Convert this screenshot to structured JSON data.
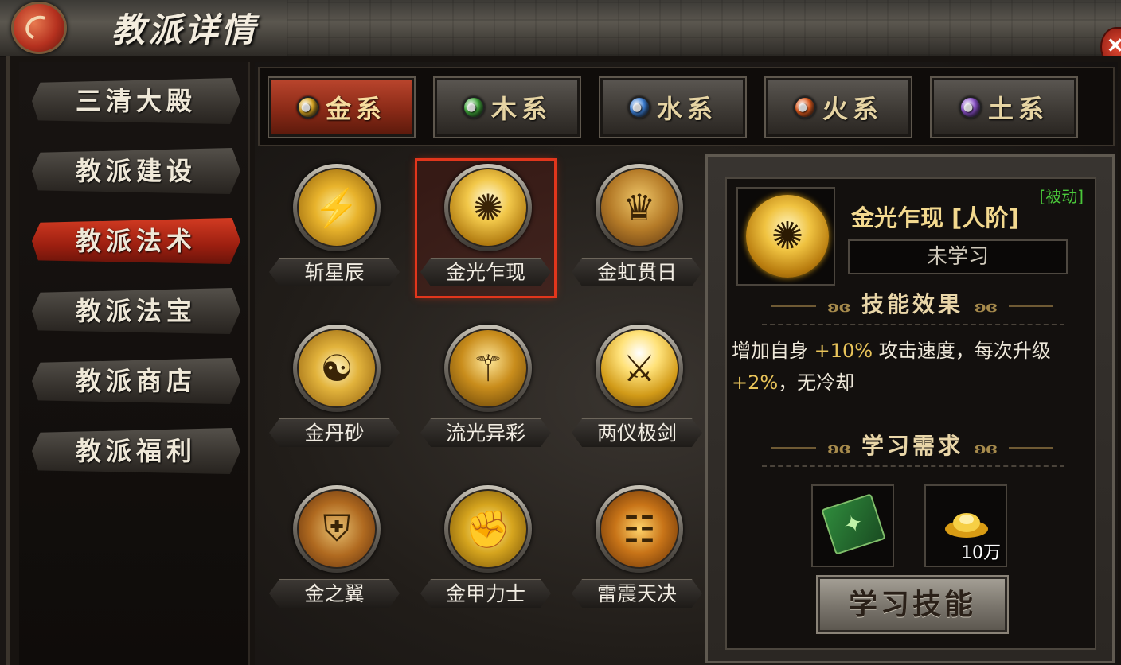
{
  "window": {
    "title": "教派详情",
    "close_symbol": "✕"
  },
  "sidebar": {
    "items": [
      {
        "label": "三清大殿",
        "active": false
      },
      {
        "label": "教派建设",
        "active": false
      },
      {
        "label": "教派法术",
        "active": true
      },
      {
        "label": "教派法宝",
        "active": false
      },
      {
        "label": "教派商店",
        "active": false
      },
      {
        "label": "教派福利",
        "active": false
      }
    ]
  },
  "tabs": [
    {
      "label": "金系",
      "active": true,
      "orb_color": "#d9a520"
    },
    {
      "label": "木系",
      "active": false,
      "orb_color": "#3fa83a"
    },
    {
      "label": "水系",
      "active": false,
      "orb_color": "#3b7fd6"
    },
    {
      "label": "火系",
      "active": false,
      "orb_color": "#e05a1c"
    },
    {
      "label": "土系",
      "active": false,
      "orb_color": "#8a4fc9"
    }
  ],
  "skills": [
    {
      "name": "斩星辰",
      "icon": "sword-lightning-icon",
      "glyph": "⚡",
      "selected": false
    },
    {
      "name": "金光乍现",
      "icon": "gourd-burst-icon",
      "glyph": "✺",
      "selected": true
    },
    {
      "name": "金虹贯日",
      "icon": "warrior-roar-icon",
      "glyph": "♛",
      "selected": false
    },
    {
      "name": "金丹砂",
      "icon": "taiji-icon",
      "glyph": "☯",
      "selected": false
    },
    {
      "name": "流光异彩",
      "icon": "sage-aura-icon",
      "glyph": "⚚",
      "selected": false
    },
    {
      "name": "两仪极剑",
      "icon": "sword-light-icon",
      "glyph": "⚔",
      "selected": false
    },
    {
      "name": "金之翼",
      "icon": "shield-icon",
      "glyph": "⛨",
      "selected": false
    },
    {
      "name": "金甲力士",
      "icon": "golden-gauntlet-icon",
      "glyph": "✊",
      "selected": false
    },
    {
      "name": "雷震天决",
      "icon": "thunder-chest-icon",
      "glyph": "☷",
      "selected": false
    }
  ],
  "detail": {
    "tag": "[被动]",
    "name": "金光乍现 [人阶]",
    "status": "未学习",
    "effect_heading": "技能效果",
    "effect_parts": [
      {
        "text": "增加自身 ",
        "highlight": false
      },
      {
        "text": "+10%",
        "highlight": true
      },
      {
        "text": " 攻击速度，每次升级 ",
        "highlight": false
      },
      {
        "text": "+2%",
        "highlight": true
      },
      {
        "text": "，无冷却",
        "highlight": false
      }
    ],
    "requirement_heading": "学习需求",
    "requirements": [
      {
        "item": "skill-book-icon",
        "glyph": "📗",
        "count": ""
      },
      {
        "item": "gold-ingot-icon",
        "glyph": "🥇",
        "count": "10万"
      }
    ],
    "learn_button": "学习技能"
  },
  "colors": {
    "accent_red": "#d23b22",
    "gold_text": "#f3d98f",
    "passive_green": "#4ac83a",
    "highlight_gold": "#e9c45a"
  }
}
